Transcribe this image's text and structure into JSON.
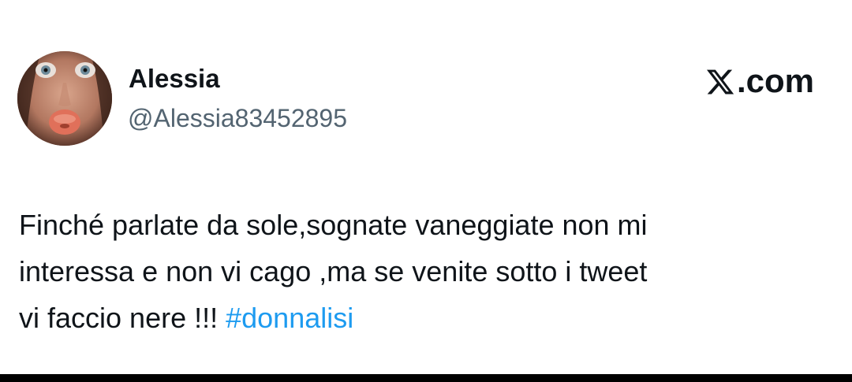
{
  "author": {
    "display_name": "Alessia",
    "handle": "@Alessia83452895",
    "avatar_icon": "profile-photo"
  },
  "brand": {
    "logo_icon": "x-logo-icon",
    "suffix": ".com"
  },
  "tweet": {
    "line1": "Finché parlate da sole,sognate vaneggiate non mi",
    "line2": "interessa e non vi cago ,ma se venite sotto i tweet",
    "line3_text": "vi faccio nere !!! ",
    "hashtag": "#donnalisi"
  },
  "colors": {
    "text": "#0f1419",
    "secondary": "#536471",
    "link": "#1d9bf0",
    "bottom_bar": "#000000"
  }
}
